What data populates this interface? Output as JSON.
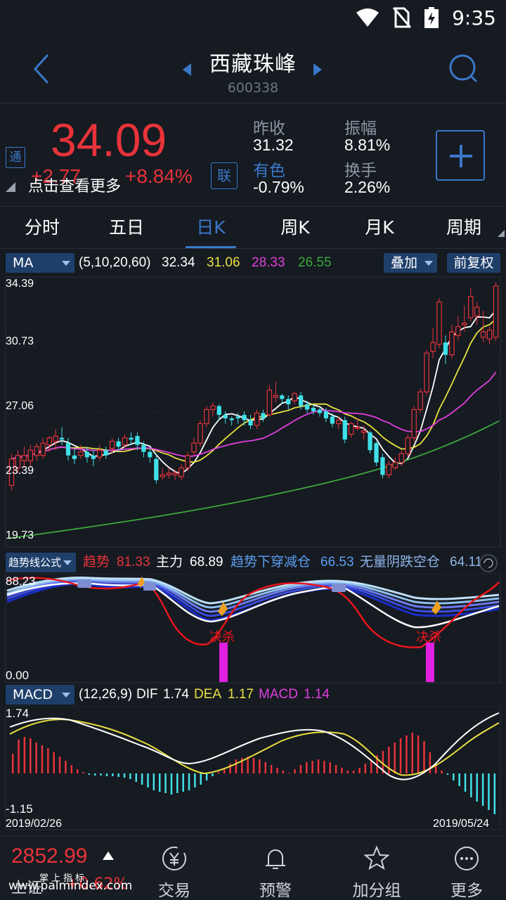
{
  "status_bar": {
    "time": "9:35",
    "icons": [
      "wifi-icon",
      "no-sim-icon",
      "battery-charging-icon"
    ]
  },
  "header": {
    "title": "西藏珠峰",
    "code": "600338"
  },
  "quote": {
    "badge": "通",
    "price": "34.09",
    "change": "+2.77",
    "change_pct": "+8.84%",
    "overlay_hint": "点击查看更多",
    "lian_label": "联",
    "stats": {
      "prev_close_label": "昨收",
      "prev_close": "31.32",
      "sector_label": "有色",
      "sector_change": "-0.79%",
      "amplitude_label": "振幅",
      "amplitude": "8.81%",
      "turnover_label": "换手",
      "turnover": "2.26%"
    },
    "colors": {
      "up": "#e8333a",
      "accent": "#3a78c9"
    }
  },
  "tabs": [
    {
      "label": "分时",
      "active": false
    },
    {
      "label": "五日",
      "active": false
    },
    {
      "label": "日K",
      "active": true
    },
    {
      "label": "周K",
      "active": false
    },
    {
      "label": "月K",
      "active": false
    },
    {
      "label": "周期",
      "active": false
    }
  ],
  "ma_panel": {
    "selector": "MA",
    "params": "(5,10,20,60)",
    "values": [
      {
        "value": "32.34",
        "color": "#ffffff"
      },
      {
        "value": "31.06",
        "color": "#e8e040"
      },
      {
        "value": "28.33",
        "color": "#e040e0"
      },
      {
        "value": "26.55",
        "color": "#3aa83a"
      }
    ],
    "overlay_btn": "叠加",
    "adjust_btn": "前复权",
    "y_ticks": [
      "34.39",
      "30.73",
      "27.06",
      "23.39",
      "19.73"
    ]
  },
  "trend_panel": {
    "selector": "趋势线公式",
    "items": [
      {
        "label": "趋势",
        "value": "81.33",
        "color": "#e8333a"
      },
      {
        "label": "主力",
        "value": "68.89",
        "color": "#ffffff"
      },
      {
        "label": "趋势下穿减仓",
        "value": "66.53",
        "color": "#5aa0f0"
      },
      {
        "label": "无量阴跌空仓",
        "value": "64.11",
        "color": "#8db4e8"
      }
    ],
    "y_ticks": [
      "88.23",
      "0.00"
    ],
    "signal_labels": [
      "决杀",
      "决杀"
    ]
  },
  "macd_panel": {
    "selector": "MACD",
    "params": "(12,26,9)",
    "items": [
      {
        "label": "DIF",
        "value": "1.74",
        "color": "#ffffff"
      },
      {
        "label": "DEA",
        "value": "1.17",
        "color": "#e8e040"
      },
      {
        "label": "MACD",
        "value": "1.14",
        "color": "#e040e0"
      }
    ],
    "y_ticks": [
      "1.74",
      "-1.15"
    ],
    "date_start": "2019/02/26",
    "date_end": "2019/05/24"
  },
  "bottom_nav": {
    "index_price": "2852.99",
    "index_name": "上证",
    "index_pct": "+0.62%",
    "watermark_line1": "掌上指标",
    "watermark_line2": "www.palmindex.com",
    "items": [
      {
        "label": "交易",
        "icon": "yen-exchange-icon"
      },
      {
        "label": "预警",
        "icon": "bell-icon"
      },
      {
        "label": "加分组",
        "icon": "star-icon"
      },
      {
        "label": "更多",
        "icon": "more-dots-icon"
      }
    ]
  },
  "chart_data": [
    {
      "type": "candlestick",
      "title": "日K",
      "ylim": [
        19.73,
        34.39
      ],
      "candles": [
        [
          22.9,
          24.4,
          22.6,
          24.7
        ],
        [
          23.9,
          24.6,
          23.6,
          24.9
        ],
        [
          24.3,
          24.6,
          23.9,
          25.1
        ],
        [
          24.3,
          24.9,
          24.0,
          25.2
        ],
        [
          24.6,
          25.1,
          24.3,
          25.3
        ],
        [
          24.6,
          25.3,
          24.4,
          25.6
        ],
        [
          25.2,
          25.6,
          24.8,
          25.7
        ],
        [
          25.4,
          25.7,
          24.9,
          26.1
        ],
        [
          25.6,
          25.5,
          25.2,
          26.2
        ],
        [
          25.3,
          24.6,
          24.3,
          25.6
        ],
        [
          24.6,
          24.4,
          24.1,
          25.0
        ],
        [
          24.6,
          24.8,
          24.4,
          25.2
        ],
        [
          24.8,
          24.5,
          24.2,
          25.1
        ],
        [
          24.6,
          24.4,
          24.0,
          24.9
        ],
        [
          24.5,
          24.9,
          24.3,
          25.2
        ],
        [
          24.9,
          24.6,
          24.4,
          25.1
        ],
        [
          25.0,
          25.4,
          24.7,
          25.6
        ],
        [
          25.4,
          25.1,
          24.8,
          25.6
        ],
        [
          25.2,
          25.6,
          25.0,
          25.8
        ],
        [
          25.6,
          25.5,
          25.2,
          25.9
        ],
        [
          25.7,
          25.2,
          24.9,
          25.9
        ],
        [
          25.2,
          24.8,
          24.5,
          25.4
        ],
        [
          24.8,
          24.5,
          24.2,
          25.0
        ],
        [
          24.4,
          23.2,
          23.0,
          24.7
        ],
        [
          23.4,
          23.5,
          23.2,
          23.9
        ],
        [
          23.5,
          23.6,
          23.3,
          23.9
        ],
        [
          23.5,
          23.6,
          23.2,
          23.8
        ],
        [
          23.4,
          23.9,
          23.2,
          24.1
        ],
        [
          23.9,
          24.6,
          23.7,
          24.8
        ],
        [
          24.8,
          25.3,
          24.6,
          25.6
        ],
        [
          25.3,
          26.4,
          25.1,
          26.6
        ],
        [
          26.4,
          27.2,
          26.2,
          27.4
        ],
        [
          27.2,
          27.4,
          26.8,
          27.6
        ],
        [
          27.4,
          26.9,
          26.6,
          27.5
        ],
        [
          26.9,
          26.7,
          26.4,
          27.1
        ],
        [
          26.7,
          26.6,
          26.3,
          26.8
        ],
        [
          26.8,
          26.7,
          26.4,
          27.0
        ],
        [
          26.9,
          26.6,
          26.3,
          27.1
        ],
        [
          26.6,
          26.3,
          26.1,
          26.9
        ],
        [
          26.3,
          27.0,
          26.1,
          27.2
        ],
        [
          27.0,
          26.7,
          26.5,
          27.2
        ],
        [
          26.9,
          28.3,
          26.8,
          28.6
        ],
        [
          27.9,
          28.0,
          27.6,
          28.8
        ],
        [
          28.0,
          27.8,
          27.5,
          28.1
        ],
        [
          27.8,
          27.5,
          27.2,
          28.0
        ],
        [
          27.7,
          28.1,
          27.5,
          28.2
        ],
        [
          28.0,
          27.4,
          27.2,
          28.2
        ],
        [
          27.5,
          27.2,
          27.0,
          27.7
        ],
        [
          27.3,
          27.1,
          26.9,
          27.5
        ],
        [
          27.2,
          27.0,
          26.8,
          27.3
        ],
        [
          27.1,
          26.7,
          26.5,
          27.3
        ],
        [
          26.8,
          26.4,
          26.2,
          27.0
        ],
        [
          26.4,
          26.6,
          26.1,
          26.8
        ],
        [
          26.6,
          25.5,
          25.3,
          26.8
        ],
        [
          25.8,
          26.4,
          25.6,
          26.5
        ],
        [
          26.2,
          26.2,
          26.0,
          26.7
        ],
        [
          25.9,
          26.0,
          25.5,
          26.3
        ],
        [
          25.9,
          24.9,
          24.7,
          26.0
        ],
        [
          25.3,
          24.2,
          24.0,
          25.4
        ],
        [
          24.5,
          23.5,
          23.3,
          24.7
        ],
        [
          23.5,
          24.1,
          23.3,
          24.3
        ],
        [
          23.9,
          24.2,
          23.8,
          24.5
        ],
        [
          24.2,
          24.7,
          24.0,
          24.9
        ],
        [
          24.7,
          25.6,
          24.5,
          25.8
        ],
        [
          25.6,
          27.2,
          25.4,
          27.4
        ],
        [
          27.2,
          28.2,
          27.0,
          28.4
        ],
        [
          28.2,
          30.4,
          28.0,
          30.6
        ],
        [
          30.5,
          31.0,
          30.1,
          31.8
        ],
        [
          30.9,
          33.3,
          30.7,
          33.5
        ],
        [
          31.0,
          30.3,
          29.8,
          31.4
        ],
        [
          30.3,
          31.6,
          30.1,
          32.0
        ],
        [
          31.4,
          31.9,
          31.1,
          32.5
        ],
        [
          32.0,
          32.1,
          31.6,
          33.1
        ],
        [
          32.4,
          33.6,
          32.2,
          34.1
        ],
        [
          32.5,
          33.0,
          32.0,
          33.3
        ],
        [
          31.3,
          31.6,
          31.0,
          32.8
        ],
        [
          31.2,
          31.7,
          30.9,
          31.9
        ],
        [
          31.3,
          34.2,
          31.1,
          34.4
        ]
      ]
    },
    {
      "type": "line",
      "title": "趋势线公式",
      "ylim": [
        0,
        88.23
      ]
    },
    {
      "type": "bar",
      "title": "MACD",
      "ylim": [
        -1.15,
        1.74
      ]
    }
  ]
}
